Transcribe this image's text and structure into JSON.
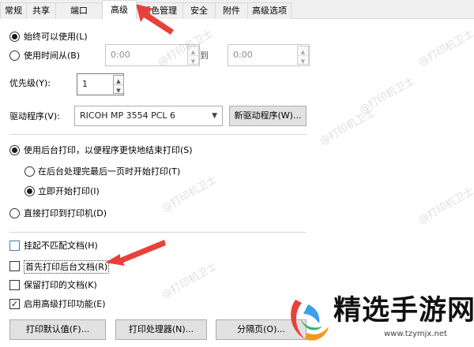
{
  "tabs": [
    "常规",
    "共享",
    "端口",
    "高级",
    "颜色管理",
    "安全",
    "附件",
    "高级选项"
  ],
  "active_tab": "高级",
  "availability": {
    "always_label": "始终可以使用(L)",
    "time_label": "使用时间从(B)",
    "from_value": "0:00",
    "to_label": "到",
    "to_value": "0:00"
  },
  "priority": {
    "label": "优先级(Y):",
    "value": "1"
  },
  "driver": {
    "label": "驱动程序(V):",
    "selected": "RICOH MP 3554 PCL 6",
    "new_driver_button": "新驱动程序(W)..."
  },
  "spool": {
    "spool_label": "使用后台打印，以便程序更快地结束打印(S)",
    "after_last_page_label": "在后台处理完最后一页时开始打印(T)",
    "immediately_label": "立即开始打印(I)",
    "direct_label": "直接打印到打印机(D)"
  },
  "options": {
    "hold_mismatched": {
      "label": "挂起不匹配文档(H)",
      "checked": false
    },
    "print_spooled_first": {
      "label": "首先打印后台文档(R)",
      "checked": false
    },
    "keep_printed": {
      "label": "保留打印的文档(K)",
      "checked": false
    },
    "advanced_features": {
      "label": "启用高级打印功能(E)",
      "checked": true
    }
  },
  "buttons": {
    "defaults": "打印默认值(F)...",
    "processor": "打印处理器(N)...",
    "separator_page": "分隔页(O)..."
  },
  "watermark_text": "@打印机卫士",
  "logo": {
    "name": "精选手游网",
    "url": "www.tzymjx.net"
  },
  "colors": {
    "arrow_red": "#e8403a",
    "tab_border": "#d9d9d9",
    "button_bg": "#e1e1e1"
  }
}
